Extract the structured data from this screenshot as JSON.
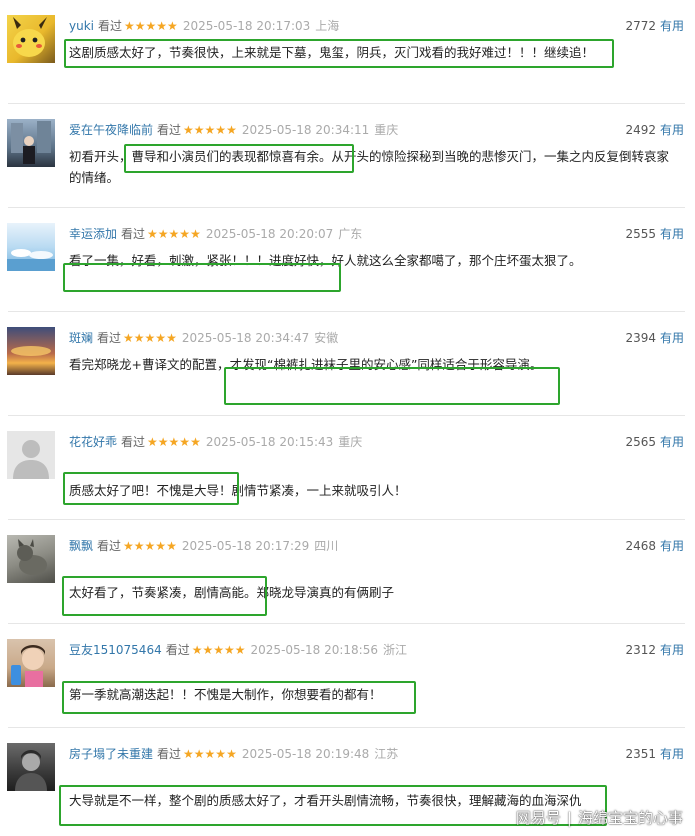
{
  "comments": [
    {
      "user": "yuki",
      "status": "看过",
      "stars": "★★★★★",
      "time": "2025-05-18 20:17:03",
      "location": "上海",
      "votes": "2772",
      "vote_label": "有用",
      "text": "这剧质感太好了，节奏很快，上来就是下墓，鬼玺，阴兵，灭门戏看的我好难过！！！继续追！"
    },
    {
      "user": "爱在午夜降临前",
      "status": "看过",
      "stars": "★★★★★",
      "time": "2025-05-18 20:34:11",
      "location": "重庆",
      "votes": "2492",
      "vote_label": "有用",
      "text": "初看开头，曹导和小演员们的表现都惊喜有余。从开头的惊险探秘到当晚的悲惨灭门，一集之内反复倒转哀家的情绪。"
    },
    {
      "user": "幸运添加",
      "status": "看过",
      "stars": "★★★★★",
      "time": "2025-05-18 20:20:07",
      "location": "广东",
      "votes": "2555",
      "vote_label": "有用",
      "text": "看了一集，好看，刺激，紧张！！！进度好快，好人就这么全家都噶了，那个庄坏蛋太狠了。"
    },
    {
      "user": "斑斓",
      "status": "看过",
      "stars": "★★★★★",
      "time": "2025-05-18 20:34:47",
      "location": "安徽",
      "votes": "2394",
      "vote_label": "有用",
      "text": "看完郑晓龙+曹译文的配置，才发现“棉裤扎进袜子里的安心感”同样适合于形容导演。"
    },
    {
      "user": "花花好乖",
      "status": "看过",
      "stars": "★★★★★",
      "time": "2025-05-18 20:15:43",
      "location": "重庆",
      "votes": "2565",
      "vote_label": "有用",
      "text": "质感太好了吧！不愧是大导！剧情节紧凑，一上来就吸引人！"
    },
    {
      "user": "飘飘",
      "status": "看过",
      "stars": "★★★★★",
      "time": "2025-05-18 20:17:29",
      "location": "四川",
      "votes": "2468",
      "vote_label": "有用",
      "text": "太好看了，节奏紧凑，剧情高能。郑晓龙导演真的有俩刷子"
    },
    {
      "user": "豆友151075464",
      "status": "看过",
      "stars": "★★★★★",
      "time": "2025-05-18 20:18:56",
      "location": "浙江",
      "votes": "2312",
      "vote_label": "有用",
      "text": "第一季就高潮迭起！！不愧是大制作，你想要看的都有！"
    },
    {
      "user": "房子塌了未重建",
      "status": "看过",
      "stars": "★★★★★",
      "time": "2025-05-18 20:19:48",
      "location": "江苏",
      "votes": "2351",
      "vote_label": "有用",
      "text": "大导就是不一样，整个剧的质感太好了，才看开头剧情流畅，节奏很快，理解藏海的血海深仇"
    }
  ],
  "watermark": {
    "platform": "网易号",
    "author": "海绵宝宝的心事"
  },
  "colors": {
    "highlight": "#2da52d",
    "username": "#3377aa",
    "star": "#f5a623"
  }
}
